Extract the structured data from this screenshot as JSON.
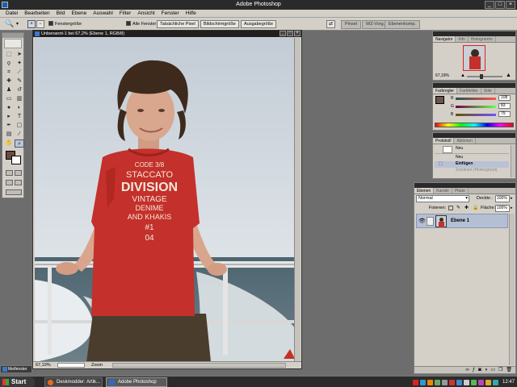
{
  "window": {
    "title": "Adobe Photoshop"
  },
  "menu": [
    "Datei",
    "Bearbeiten",
    "Bild",
    "Ebene",
    "Auswahl",
    "Filter",
    "Ansicht",
    "Fenster",
    "Hilfe"
  ],
  "options": {
    "fenstergroesse": "Fenstergröße",
    "alle_fenster": "Alle Fenster",
    "tatsaechliche_pixel": "Tatsächliche Pixel",
    "bildschirmgroesse": "Bildschirmgröße",
    "ausgabegroesse": "Ausgabegröße",
    "well_tabs": [
      "Pinsel",
      "WZ-Vorg.",
      "Ebenenkomp."
    ]
  },
  "document": {
    "title": "Unbenannt-1 bei 67,2% (Ebene 1, RGB/8)",
    "zoom": "67,19%",
    "status_label": "Zoom",
    "shirt_text": [
      "CODE 3/8",
      "STACCATO",
      "DIVISION",
      "VINTAGE",
      "DENIME",
      "AND KHAKIS",
      "#1",
      "04"
    ]
  },
  "navigator": {
    "tabs": [
      "Navigator",
      "Info",
      "Histogramm"
    ],
    "zoom": "67,19%"
  },
  "color_panel": {
    "tabs": [
      "Farbregler",
      "Farbfelder",
      "Stile"
    ],
    "channels": [
      {
        "label": "R",
        "value": "108"
      },
      {
        "label": "G",
        "value": "83"
      },
      {
        "label": "B",
        "value": "75"
      }
    ],
    "fg_color": "#6c534b"
  },
  "history": {
    "tabs": [
      "Protokoll",
      "Aktionen"
    ],
    "snapshot": "Neu",
    "items": [
      "Neu",
      "Einfügen",
      "Zeichnen (Hintergrund)"
    ]
  },
  "layers": {
    "tabs": [
      "Ebenen",
      "Kanäle",
      "Pfade"
    ],
    "blend_mode": "Normal",
    "opacity_label": "Deckkr.:",
    "opacity": "100%",
    "lock_label": "Fixieren:",
    "fill_label": "Fläche:",
    "fill": "100%",
    "layer_name": "Ebene 1"
  },
  "taskbar": {
    "start": "Start",
    "tasks": [
      "Deskmodder: Artik...",
      "Adobe Photoshop"
    ],
    "clock": "12:47",
    "minimized": "Metfenster"
  }
}
